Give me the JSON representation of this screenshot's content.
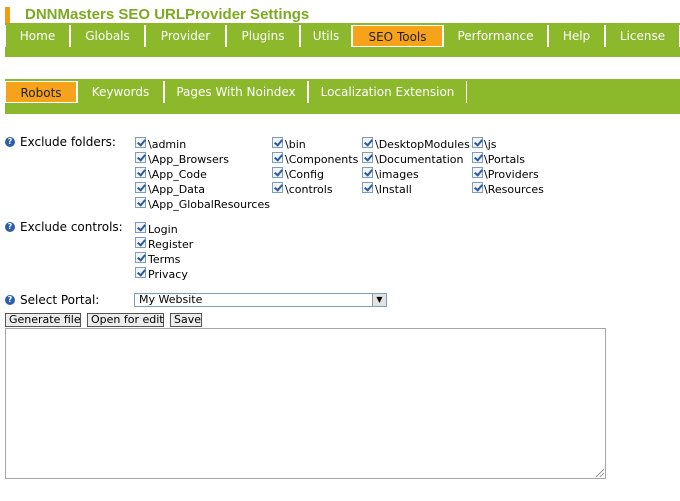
{
  "title": "DNNMasters SEO URLProvider Settings",
  "colors": {
    "accent": "#f7a21b",
    "band": "#8cb82b",
    "title": "#7ba91f"
  },
  "main_tabs": [
    {
      "label": "Home"
    },
    {
      "label": "Globals"
    },
    {
      "label": "Provider"
    },
    {
      "label": "Plugins"
    },
    {
      "label": "Utils"
    },
    {
      "label": "SEO Tools",
      "active": true
    },
    {
      "label": "Performance"
    },
    {
      "label": "Help"
    },
    {
      "label": "License"
    }
  ],
  "sub_tabs": [
    {
      "label": "Robots",
      "active": true
    },
    {
      "label": "Keywords"
    },
    {
      "label": "Pages With Noindex"
    },
    {
      "label": "Localization Extension"
    }
  ],
  "exclude_folders": {
    "label": "Exclude folders:",
    "items": [
      "\\admin",
      "\\App_Browsers",
      "\\App_Code",
      "\\App_Data",
      "\\App_GlobalResources",
      "\\bin",
      "\\Components",
      "\\Config",
      "\\controls",
      "\\DesktopModules",
      "\\Documentation",
      "\\images",
      "\\Install",
      "\\js",
      "\\Portals",
      "\\Providers",
      "\\Resources"
    ]
  },
  "exclude_controls": {
    "label": "Exclude controls:",
    "items": [
      "Login",
      "Register",
      "Terms",
      "Privacy"
    ]
  },
  "select_portal": {
    "label": "Select Portal:",
    "value": "My Website"
  },
  "buttons": {
    "generate": "Generate file",
    "open": "Open for edit",
    "save": "Save"
  }
}
